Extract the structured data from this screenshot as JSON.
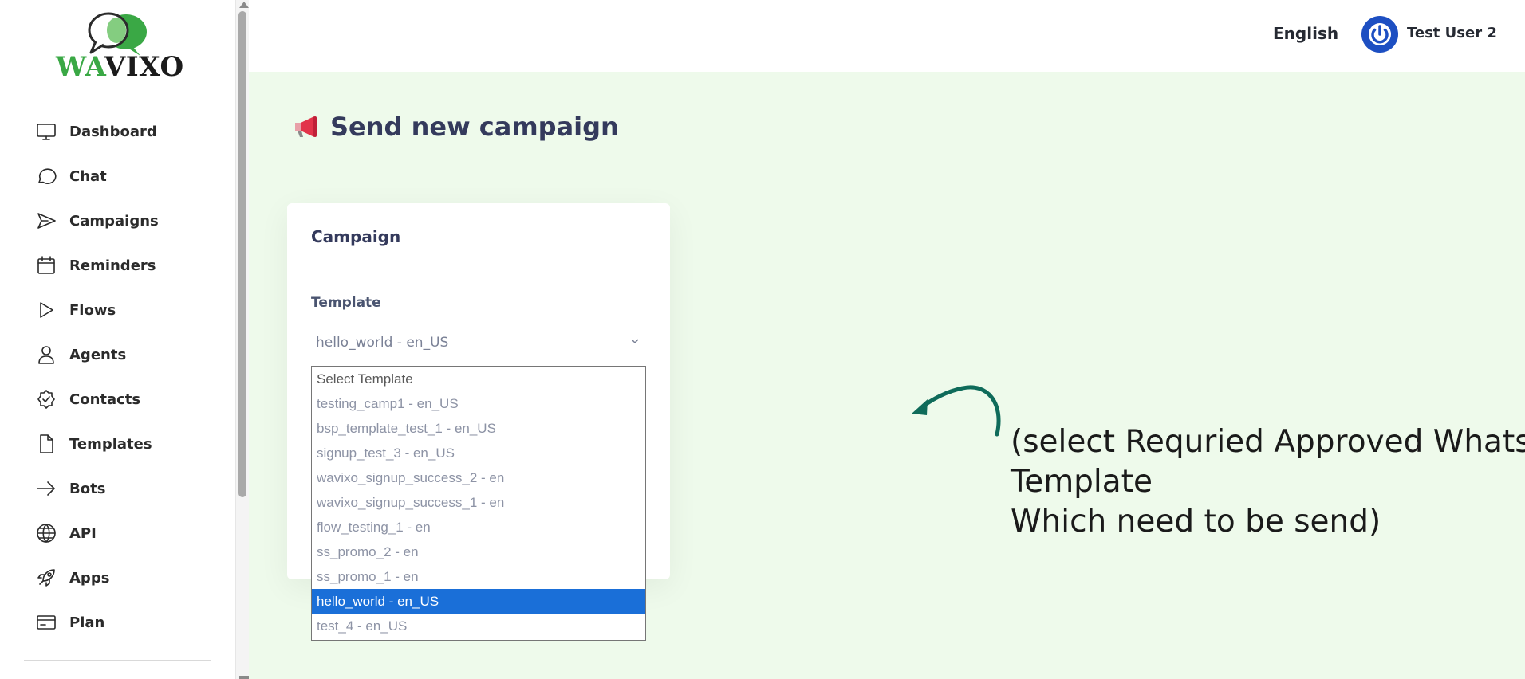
{
  "brand": {
    "logo_text_a": "WA",
    "logo_text_b": "VIXO",
    "colors": {
      "green": "#3aa845",
      "dark": "#1b1b1b"
    }
  },
  "sidebar": {
    "items": [
      {
        "label": "Dashboard",
        "icon": "monitor-icon"
      },
      {
        "label": "Chat",
        "icon": "chat-bubble-icon"
      },
      {
        "label": "Campaigns",
        "icon": "send-icon"
      },
      {
        "label": "Reminders",
        "icon": "calendar-icon"
      },
      {
        "label": "Flows",
        "icon": "play-icon"
      },
      {
        "label": "Agents",
        "icon": "person-icon"
      },
      {
        "label": "Contacts",
        "icon": "badge-check-icon"
      },
      {
        "label": "Templates",
        "icon": "file-icon"
      },
      {
        "label": "Bots",
        "icon": "arrow-right-icon"
      },
      {
        "label": "API",
        "icon": "globe-icon"
      },
      {
        "label": "Apps",
        "icon": "rocket-icon"
      },
      {
        "label": "Plan",
        "icon": "credit-card-icon"
      }
    ]
  },
  "header": {
    "language": "English",
    "user_name": "Test User 2",
    "avatar_color": "#1d4fc2"
  },
  "main": {
    "page_title": "Send new campaign",
    "title_icon": "megaphone-icon",
    "background": "#eefaeb",
    "card": {
      "title": "Campaign",
      "template_label": "Template",
      "template_value": "hello_world - en_US"
    },
    "dropdown": {
      "options": [
        "Select Template",
        "testing_camp1 - en_US",
        "bsp_template_test_1 - en_US",
        "signup_test_3 - en_US",
        "wavixo_signup_success_2 - en",
        "wavixo_signup_success_1 - en",
        "flow_testing_1 - en",
        "ss_promo_2 - en",
        "ss_promo_1 - en",
        "hello_world - en_US",
        "test_4 - en_US"
      ],
      "selected": "hello_world - en_US",
      "selected_color": "#1a6fd8"
    },
    "annotation": {
      "line1": "(select Requried Approved Whatsapp Template",
      "line2": "Which need to be send)",
      "arrow_color": "#0f6b5a"
    }
  }
}
